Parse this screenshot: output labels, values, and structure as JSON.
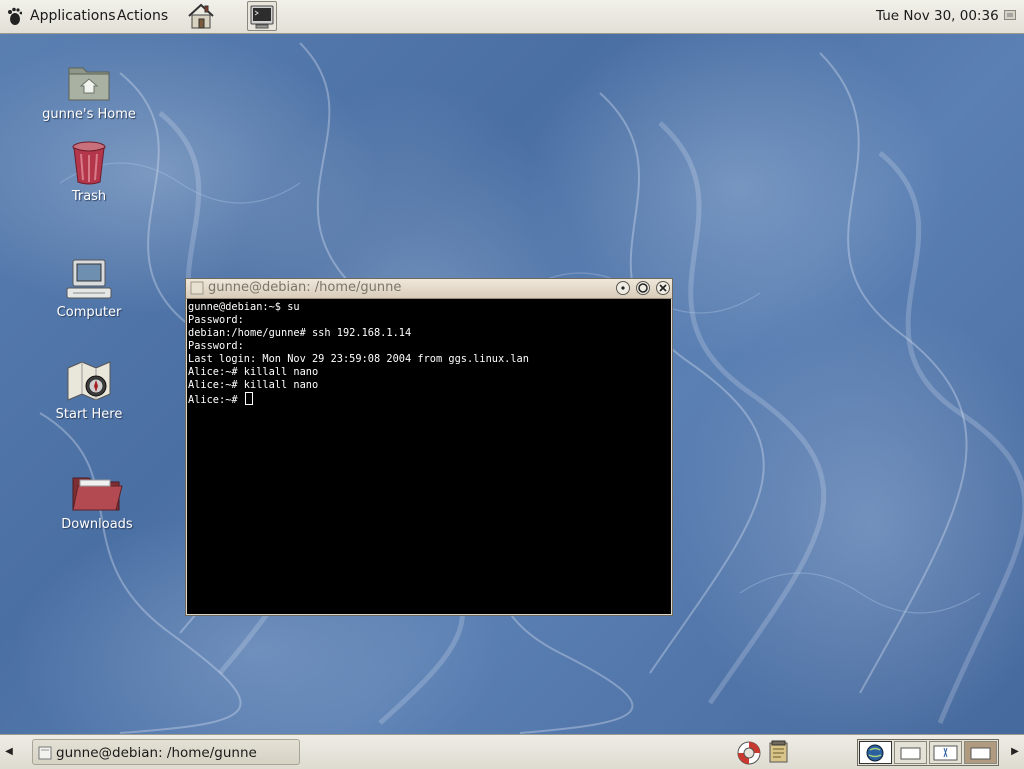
{
  "top_panel": {
    "menus": [
      "Applications",
      "Actions"
    ],
    "clock": "Tue Nov 30, 00:36"
  },
  "desktop": {
    "icons": [
      {
        "label": "gunne's Home"
      },
      {
        "label": "Trash"
      },
      {
        "label": "Computer"
      },
      {
        "label": "Start Here"
      },
      {
        "label": "Downloads"
      }
    ]
  },
  "terminal": {
    "title": "gunne@debian: /home/gunne",
    "lines": [
      "gunne@debian:~$ su",
      "Password:",
      "debian:/home/gunne# ssh 192.168.1.14",
      "Password:",
      "Last login: Mon Nov 29 23:59:08 2004 from ggs.linux.lan",
      "Alice:~# killall nano",
      "Alice:~# killall nano",
      "Alice:~# "
    ]
  },
  "taskbar": {
    "tasks": [
      {
        "label": "gunne@debian: /home/gunne"
      }
    ]
  },
  "colors": {
    "desktop_bg": "#4f74a8",
    "panel_bg": "#e8e6dc",
    "terminal_bg": "#000000",
    "terminal_fg": "#ffffff"
  }
}
